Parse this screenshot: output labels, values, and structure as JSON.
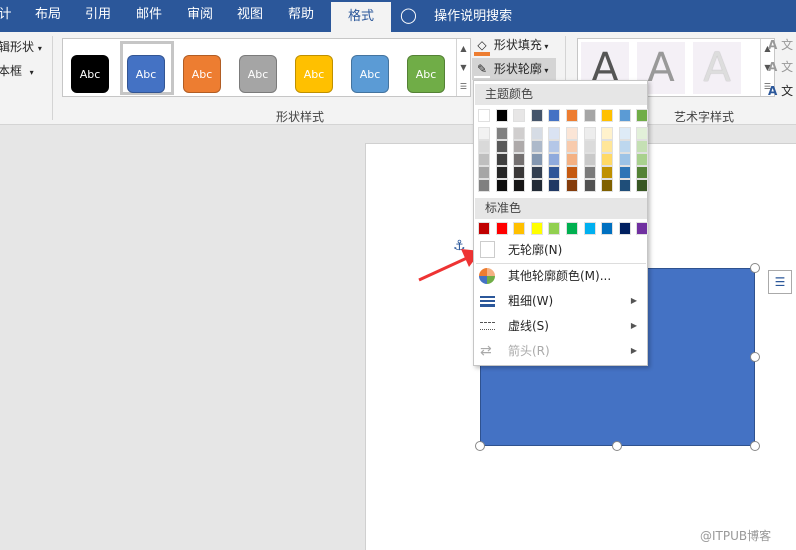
{
  "tabs": [
    "计",
    "布局",
    "引用",
    "邮件",
    "审阅",
    "视图",
    "帮助",
    "格式"
  ],
  "active_tab": "格式",
  "search_label": "操作说明搜索",
  "ribbon": {
    "left_items": [
      "辑形状",
      "本框"
    ],
    "shape_styles": {
      "label": "形状样式",
      "sample_text": "Abc",
      "fills": [
        "#000000",
        "#4472c4",
        "#ed7d31",
        "#a5a5a5",
        "#ffc000",
        "#5b9bd5",
        "#70ad47"
      ],
      "selected_index": 1
    },
    "shape_fill": "形状填充",
    "shape_outline": "形状轮廓",
    "wordart": {
      "label": "艺术字样式",
      "sample": "A",
      "right_items": [
        "文",
        "文",
        "文"
      ]
    }
  },
  "outline_menu": {
    "theme_header": "主题颜色",
    "theme_colors": [
      "#ffffff",
      "#000000",
      "#e7e6e6",
      "#44546a",
      "#4472c4",
      "#ed7d31",
      "#a5a5a5",
      "#ffc000",
      "#5b9bd5",
      "#70ad47"
    ],
    "theme_shades": [
      [
        "#f2f2f2",
        "#d9d9d9",
        "#bfbfbf",
        "#a6a6a6",
        "#808080"
      ],
      [
        "#808080",
        "#595959",
        "#404040",
        "#262626",
        "#0d0d0d"
      ],
      [
        "#d0cece",
        "#aeaaaa",
        "#757171",
        "#3a3838",
        "#171616"
      ],
      [
        "#d6dce5",
        "#adb9ca",
        "#8497b0",
        "#333f50",
        "#222a35"
      ],
      [
        "#dae3f3",
        "#b4c7e7",
        "#8faadc",
        "#2f5597",
        "#203864"
      ],
      [
        "#fbe5d6",
        "#f8cbad",
        "#f4b183",
        "#c55a11",
        "#843c0c"
      ],
      [
        "#ededed",
        "#dbdbdb",
        "#c9c9c9",
        "#7b7b7b",
        "#525252"
      ],
      [
        "#fff2cc",
        "#ffe699",
        "#ffd966",
        "#bf9000",
        "#7f6000"
      ],
      [
        "#deebf7",
        "#bdd7ee",
        "#9dc3e6",
        "#2e75b6",
        "#1f4e79"
      ],
      [
        "#e2f0d9",
        "#c5e0b4",
        "#a9d18e",
        "#548235",
        "#385723"
      ]
    ],
    "standard_header": "标准色",
    "standard_colors": [
      "#c00000",
      "#ff0000",
      "#ffc000",
      "#ffff00",
      "#92d050",
      "#00b050",
      "#00b0f0",
      "#0070c0",
      "#002060",
      "#7030a0"
    ],
    "no_outline": "无轮廓(N)",
    "more_colors": "其他轮廓颜色(M)...",
    "weight": "粗细(W)",
    "dashes": "虚线(S)",
    "arrows": "箭头(R)"
  },
  "watermark": "@ITPUB博客"
}
